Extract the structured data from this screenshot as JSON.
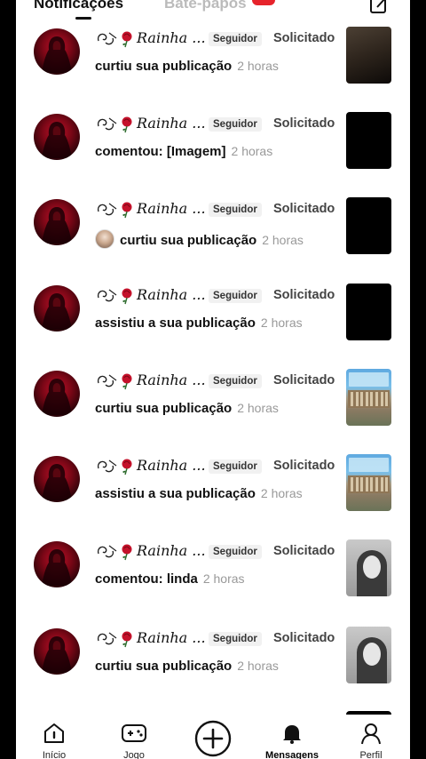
{
  "tabs": {
    "notifications": "Notificações",
    "chats": "Bate-papos"
  },
  "notifications": [
    {
      "username": "Rainha ...",
      "relationship": "Seguidor",
      "status": "Solicitado",
      "action": "curtiu sua publicação",
      "time": "2 horas",
      "thumbnail": "room-photo"
    },
    {
      "username": "Rainha ...",
      "relationship": "Seguidor",
      "status": "Solicitado",
      "action": "comentou: [Imagem]",
      "time": "2 horas",
      "thumbnail": "black"
    },
    {
      "username": "Rainha ...",
      "relationship": "Seguidor",
      "status": "Solicitado",
      "action": "curtiu sua publicação",
      "time": "2 horas",
      "thumbnail": "black",
      "with_mini_avatar": true
    },
    {
      "username": "Rainha ...",
      "relationship": "Seguidor",
      "status": "Solicitado",
      "action": "assistiu a sua publicação",
      "time": "2 horas",
      "thumbnail": "black"
    },
    {
      "username": "Rainha ...",
      "relationship": "Seguidor",
      "status": "Solicitado",
      "action": "curtiu sua publicação",
      "time": "2 horas",
      "thumbnail": "building"
    },
    {
      "username": "Rainha ...",
      "relationship": "Seguidor",
      "status": "Solicitado",
      "action": "assistiu a sua publicação",
      "time": "2 horas",
      "thumbnail": "building"
    },
    {
      "username": "Rainha ...",
      "relationship": "Seguidor",
      "status": "Solicitado",
      "action": "comentou: linda",
      "time": "2 horas",
      "thumbnail": "girl-photo"
    },
    {
      "username": "Rainha ...",
      "relationship": "Seguidor",
      "status": "Solicitado",
      "action": "curtiu sua publicação",
      "time": "2 horas",
      "thumbnail": "girl-photo"
    }
  ],
  "bottom_nav": {
    "home": "Início",
    "game": "Jogo",
    "create_icon": "plus-circle-icon",
    "messages": "Mensagens",
    "profile": "Perfil"
  },
  "colors": {
    "accent_badge": "#e6232b",
    "avatar_red": "#c2102a"
  }
}
